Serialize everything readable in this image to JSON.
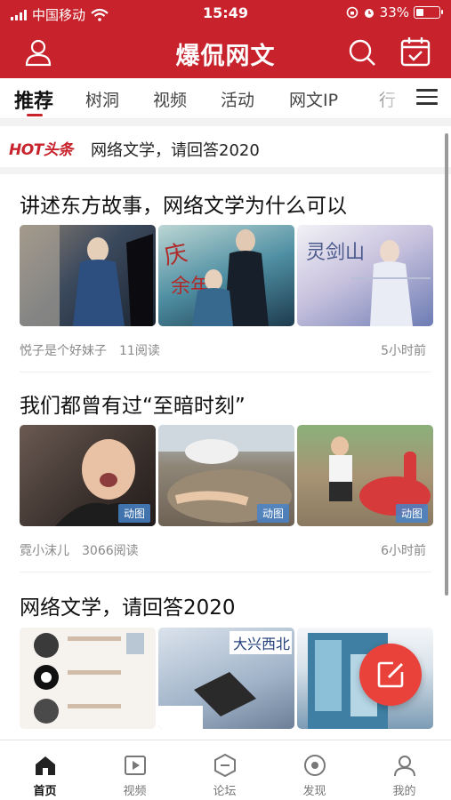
{
  "status_bar": {
    "carrier": "中国移动",
    "time": "15:49",
    "battery": "33%",
    "battery_level": 0.33,
    "icons": [
      "signal-icon",
      "wifi-icon",
      "rotation-lock-icon",
      "alarm-icon",
      "battery-icon"
    ]
  },
  "app_bar": {
    "logo": "爆侃网文",
    "icons": [
      "user-icon",
      "search-icon",
      "calendar-check-icon"
    ]
  },
  "tabs": [
    {
      "label": "推荐",
      "active": true
    },
    {
      "label": "树洞",
      "active": false
    },
    {
      "label": "视频",
      "active": false
    },
    {
      "label": "活动",
      "active": false
    },
    {
      "label": "网文IP",
      "active": false
    },
    {
      "label": "行",
      "active": false
    }
  ],
  "hot_headline": {
    "badge": "HOT头条",
    "text": "网络文学，请回答2020"
  },
  "articles": [
    {
      "title": "讲述东方故事，网络文学为什么可以",
      "author": "悦子是个好妹子",
      "reads": "11阅读",
      "time_ago": "5小时前",
      "images": [
        {
          "icon": "drama-still-image",
          "gif_label": ""
        },
        {
          "icon": "drama-poster-image",
          "gif_label": ""
        },
        {
          "icon": "drama-poster-image",
          "gif_label": ""
        }
      ]
    },
    {
      "title": "我们都曾有过“至暗时刻”",
      "author": "霓小沫儿",
      "reads": "3066阅读",
      "time_ago": "6小时前",
      "images": [
        {
          "icon": "crying-child-gif",
          "gif_label": "动图"
        },
        {
          "icon": "cat-gif",
          "gif_label": "动图"
        },
        {
          "icon": "playground-gif",
          "gif_label": "动图"
        }
      ]
    },
    {
      "title": "网络文学，请回答2020",
      "author": "",
      "reads": "",
      "time_ago": "",
      "images": [
        {
          "icon": "profile-list-image",
          "gif_label": ""
        },
        {
          "icon": "book-event-image",
          "gif_label": ""
        },
        {
          "icon": "book-cover-image",
          "gif_label": ""
        }
      ]
    }
  ],
  "bottom_nav": [
    {
      "label": "首页",
      "icon": "home-icon",
      "active": true
    },
    {
      "label": "视频",
      "icon": "video-icon",
      "active": false
    },
    {
      "label": "论坛",
      "icon": "forum-icon",
      "active": false
    },
    {
      "label": "发现",
      "icon": "discover-icon",
      "active": false
    },
    {
      "label": "我的",
      "icon": "profile-icon",
      "active": false
    }
  ],
  "colors": {
    "brand_red": "#c8232c",
    "fab_red": "#e8423a",
    "gif_badge": "#4682c8"
  }
}
